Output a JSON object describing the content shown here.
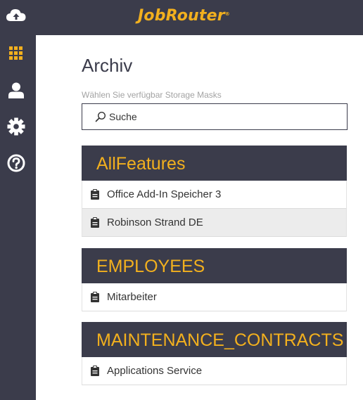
{
  "app": {
    "logo_text": "JobRouter",
    "logo_mark": "®",
    "brand_color": "#f2b01e",
    "bar_color": "#3b3c4b"
  },
  "sidebar": {
    "items": [
      {
        "icon": "cloud-upload-icon"
      },
      {
        "icon": "grid-icon",
        "active": true
      },
      {
        "icon": "user-icon"
      },
      {
        "icon": "gear-icon"
      },
      {
        "icon": "help-icon"
      }
    ]
  },
  "main": {
    "title": "Archiv",
    "hint": "Wählen Sie verfügbar Storage Masks",
    "search": {
      "placeholder": "Suche",
      "value": ""
    },
    "groups": [
      {
        "name": "AllFeatures",
        "items": [
          {
            "label": "Office Add-In Speicher 3",
            "icon": "clipboard-icon"
          },
          {
            "label": "Robinson Strand DE",
            "icon": "clipboard-icon",
            "highlighted": true
          }
        ]
      },
      {
        "name": "EMPLOYEES",
        "items": [
          {
            "label": "Mitarbeiter",
            "icon": "clipboard-icon"
          }
        ]
      },
      {
        "name": "MAINTENANCE_CONTRACTS",
        "items": [
          {
            "label": "Applications Service",
            "icon": "clipboard-icon"
          }
        ]
      }
    ]
  }
}
